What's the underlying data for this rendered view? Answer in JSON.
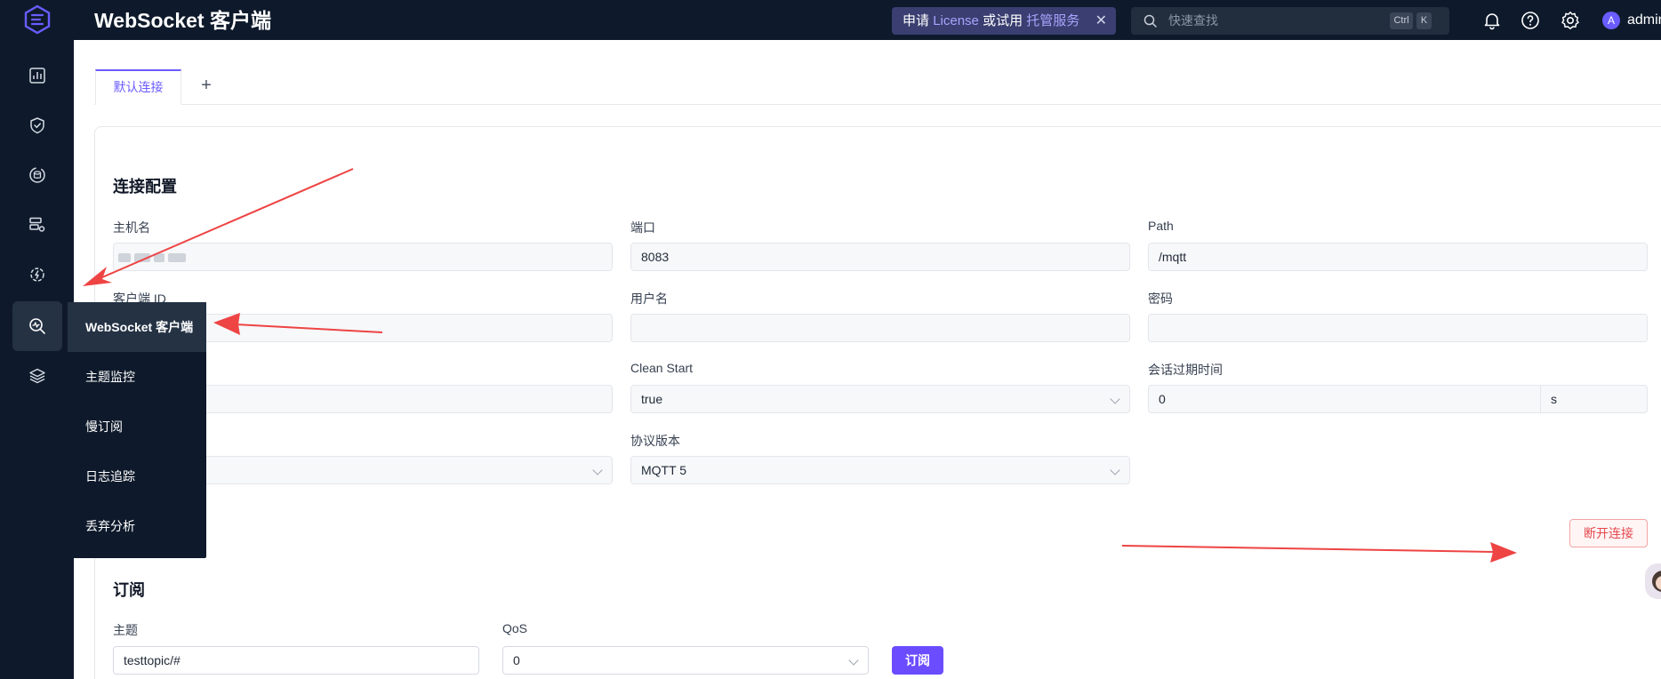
{
  "header": {
    "app_title": "WebSocket 客户端",
    "license_prefix": "申请",
    "license_link": "License",
    "license_mid": "或试用",
    "license_service": "托管服务",
    "search_placeholder": "快速查找",
    "kbd_ctrl": "Ctrl",
    "kbd_k": "K",
    "avatar_letter": "A",
    "username": "admin"
  },
  "flyout": {
    "items": [
      "WebSocket 客户端",
      "主题监控",
      "慢订阅",
      "日志追踪",
      "丢弃分析"
    ]
  },
  "tabs": {
    "active": "默认连接",
    "add": "+"
  },
  "connection": {
    "title": "连接配置",
    "host_label": "主机名",
    "port_label": "端口",
    "port_value": "8083",
    "path_label": "Path",
    "path_value": "/mqtt",
    "client_id_label": "客户端 ID",
    "username_label": "用户名",
    "password_label": "密码",
    "clean_start_label": "Clean Start",
    "clean_start_value": "true",
    "session_expiry_label": "会话过期时间",
    "session_expiry_value": "0",
    "session_expiry_unit": "s",
    "protocol_label": "协议版本",
    "protocol_value": "MQTT 5",
    "disconnect_label": "断开连接"
  },
  "subscribe": {
    "title": "订阅",
    "topic_label": "主题",
    "topic_value": "testtopic/#",
    "qos_label": "QoS",
    "qos_value": "0",
    "subscribe_label": "订阅"
  },
  "colors": {
    "sidebar_bg": "#0e1a2b",
    "accent": "#6b4cff",
    "danger": "#e5484d",
    "annotation_arrow": "#ee4444"
  }
}
